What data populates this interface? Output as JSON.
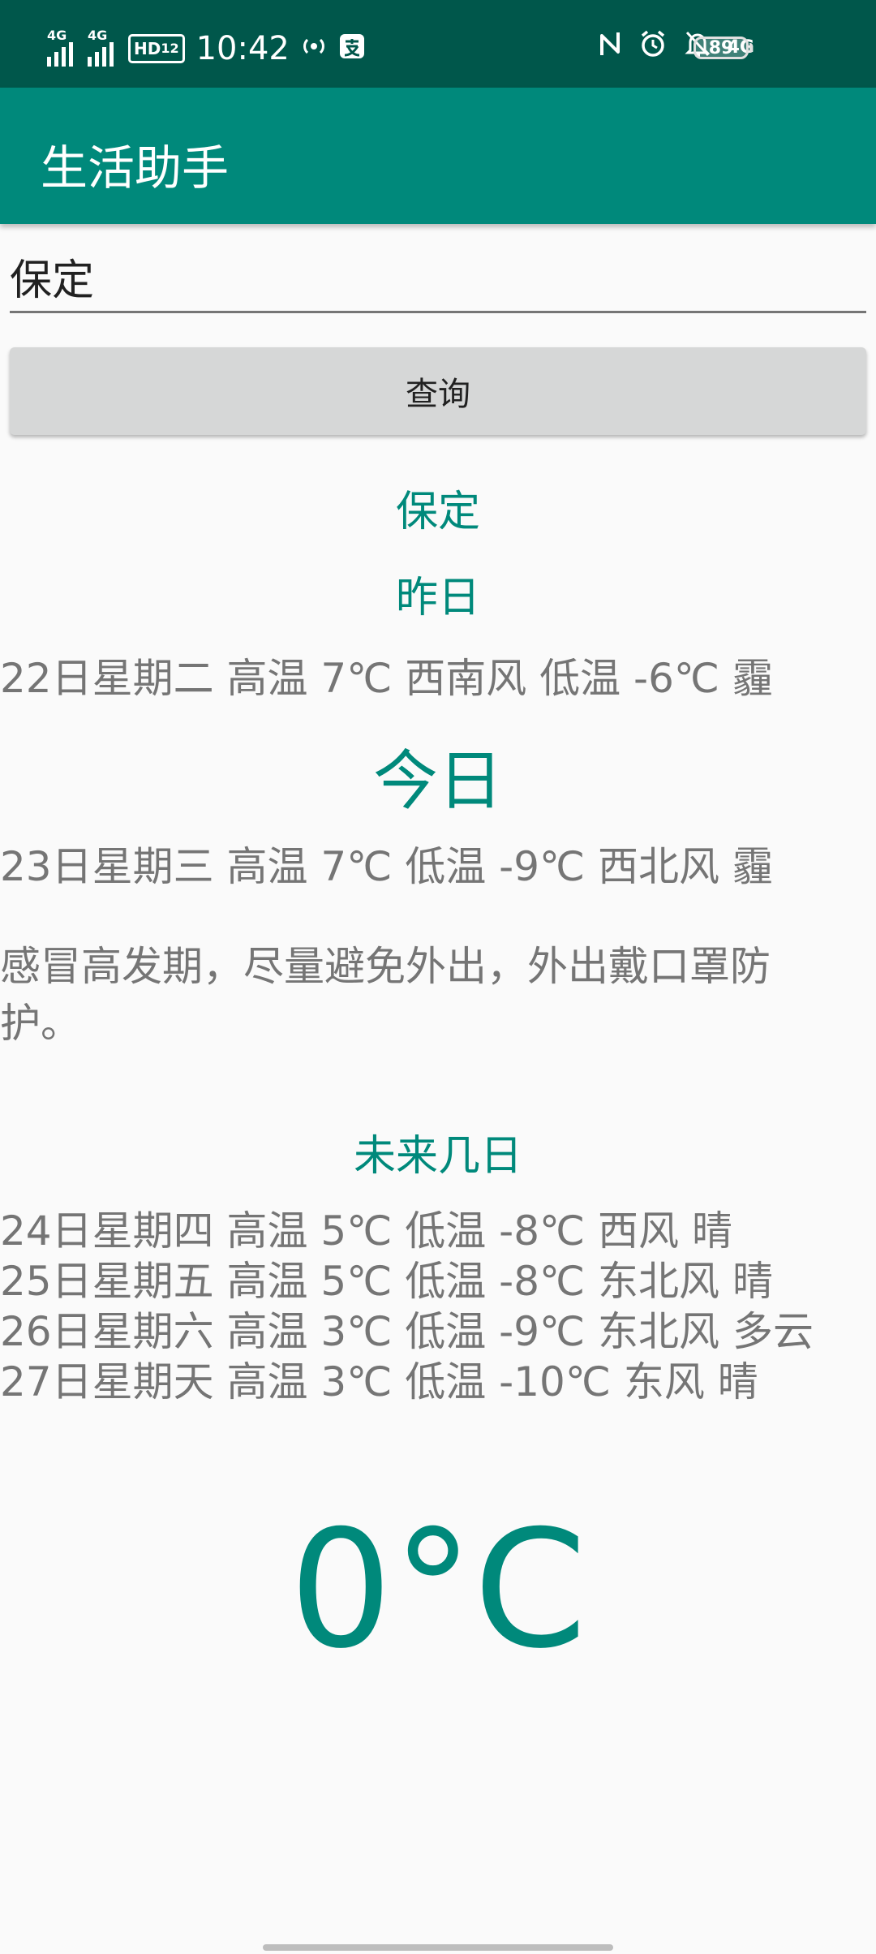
{
  "status_bar": {
    "net1": "4G",
    "net2": "4G",
    "hd": "HD",
    "hd_sub": "12",
    "time": "10:42",
    "net3": "4G",
    "battery": "89"
  },
  "app_bar": {
    "title": "生活助手"
  },
  "search": {
    "value": "保定",
    "button_label": "查询"
  },
  "weather": {
    "city": "保定",
    "yesterday_title": "昨日",
    "yesterday": "22日星期二 高温 7℃ 西南风 低温 -6℃ 霾",
    "today_title": "今日",
    "today": "23日星期三 高温 7℃ 低温 -9℃ 西北风 霾",
    "tip": "感冒高发期，尽量避免外出，外出戴口罩防护。",
    "future_title": "未来几日",
    "forecast": [
      "24日星期四 高温 5℃ 低温 -8℃ 西风 晴",
      "25日星期五 高温 5℃ 低温 -8℃ 东北风 晴",
      "26日星期六 高温 3℃ 低温 -9℃ 东北风 多云",
      "27日星期天 高温 3℃ 低温 -10℃ 东风 晴"
    ],
    "current_temp": "0°C"
  },
  "colors": {
    "status_bar": "#00574b",
    "app_bar": "#00897b",
    "accent_teal": "#00897b",
    "body_text": "#757575",
    "button_bg": "#d6d7d7"
  },
  "icons": [
    "signal-icon",
    "hd-voice-icon",
    "hotspot-icon",
    "payment-icon",
    "nfc-icon",
    "alarm-icon",
    "mute-icon",
    "battery-icon"
  ]
}
